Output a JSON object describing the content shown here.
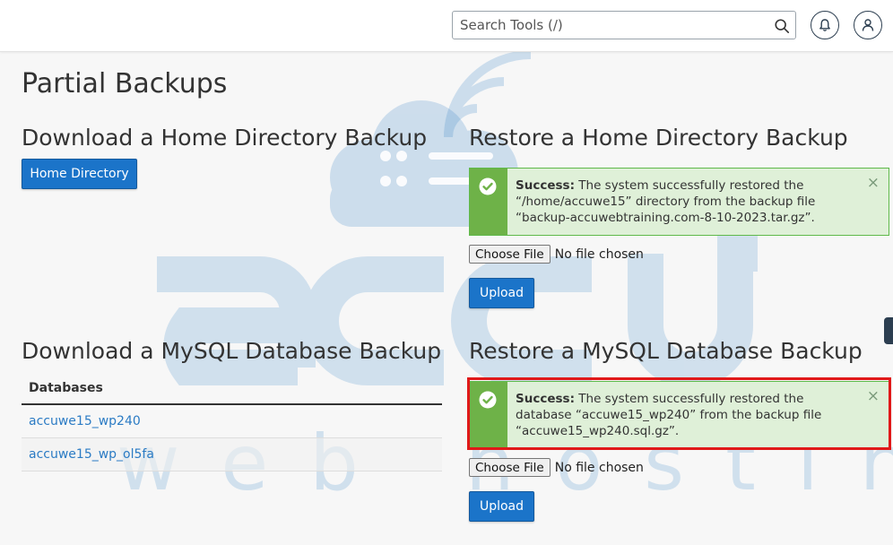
{
  "header": {
    "search_placeholder": "Search Tools (/)",
    "icons": [
      "search-icon",
      "bell-icon",
      "user-icon"
    ]
  },
  "page": {
    "title": "Partial Backups"
  },
  "download_home": {
    "heading": "Download a Home Directory Backup",
    "button_label": "Home Directory"
  },
  "restore_home": {
    "heading": "Restore a Home Directory Backup",
    "alert": {
      "strong": "Success:",
      "text": " The system successfully restored the “/home/accuwe15” directory from the backup file “backup-accuwebtraining.com-8-10-2023.tar.gz”.",
      "close": "×"
    },
    "choose_label": "Choose File",
    "no_file": "No file chosen",
    "upload_label": "Upload"
  },
  "download_mysql": {
    "heading": "Download a MySQL Database Backup",
    "table_header": "Databases",
    "rows": [
      "accuwe15_wp240",
      "accuwe15_wp_ol5fa"
    ]
  },
  "restore_mysql": {
    "heading": "Restore a MySQL Database Backup",
    "alert": {
      "strong": "Success:",
      "text": " The system successfully restored the database “accuwe15_wp240” from the backup file “accuwe15_wp240.sql.gz”.",
      "close": "×"
    },
    "choose_label": "Choose File",
    "no_file": "No file chosen",
    "upload_label": "Upload"
  },
  "watermark": {
    "brand": "accu",
    "tagline": "web hosting"
  },
  "colors": {
    "primary": "#1b74c9",
    "success_bg": "#dff0d8",
    "success_bar": "#6eb248",
    "highlight": "#e01919",
    "link": "#2b7bc4"
  }
}
